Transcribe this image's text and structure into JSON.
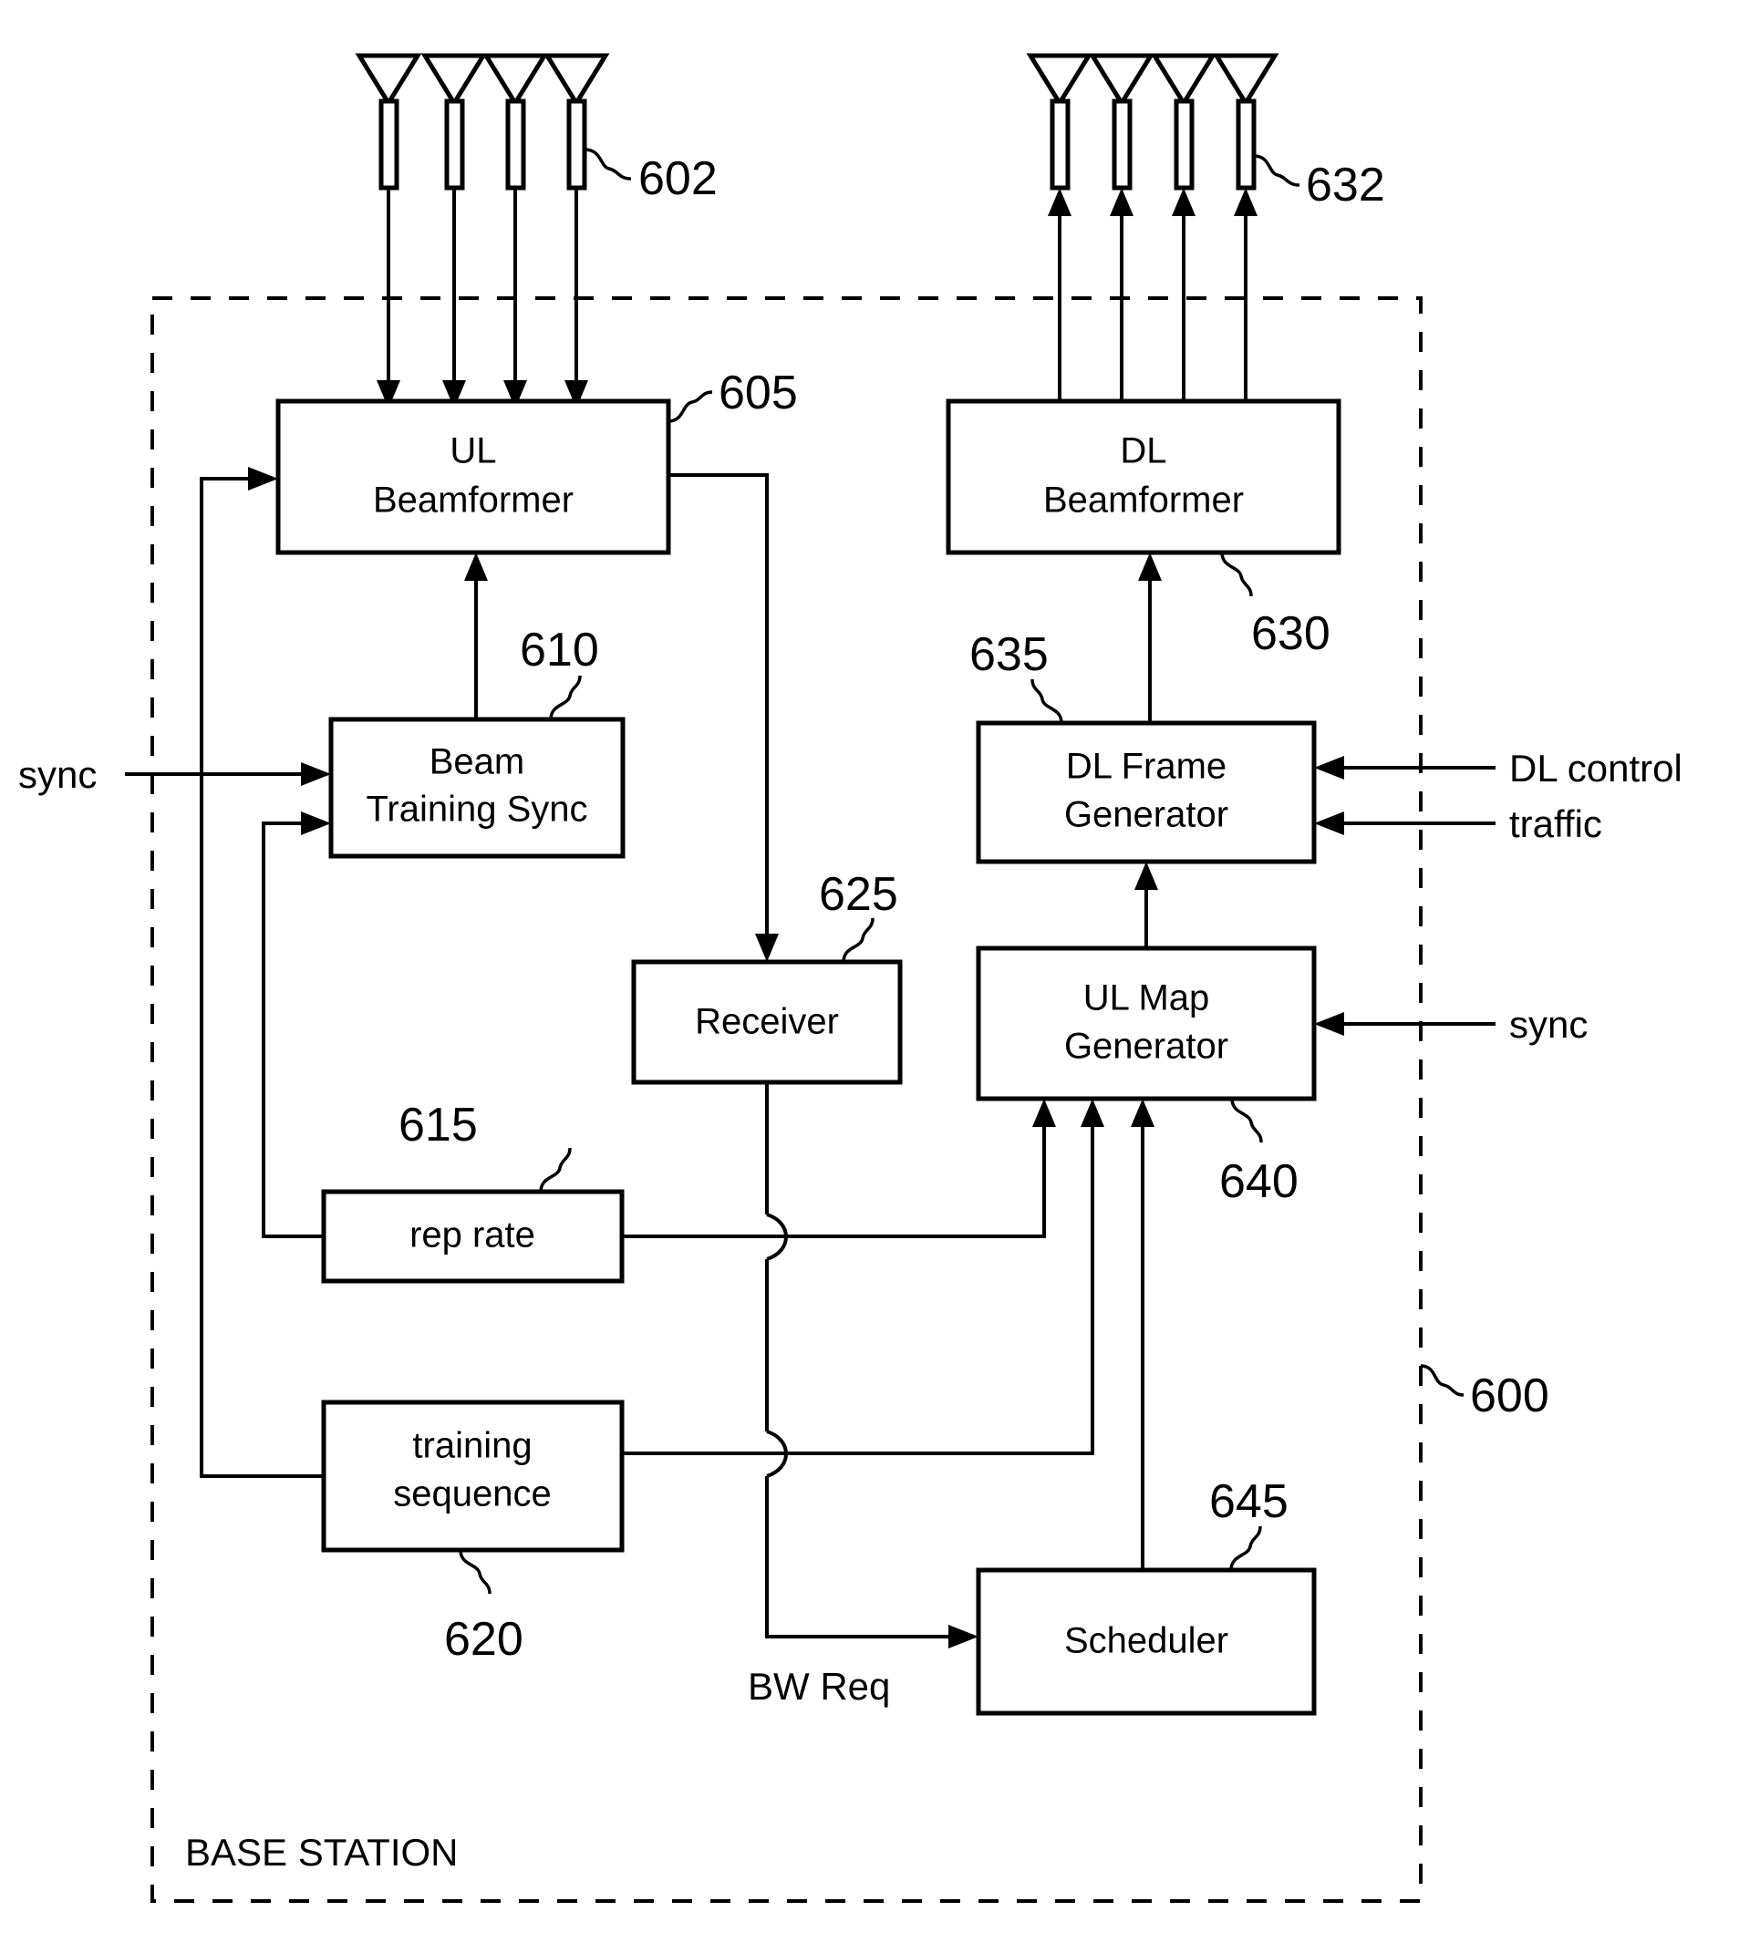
{
  "figure": {
    "frame_label": "BASE STATION",
    "frame_ref": "600"
  },
  "antennas": {
    "uplink_ref": "602",
    "downlink_ref": "632",
    "uplink_count": 4,
    "downlink_count": 4
  },
  "blocks": [
    {
      "id": "ul_beamformer",
      "line1": "UL",
      "line2": "Beamformer",
      "ref": "605"
    },
    {
      "id": "beam_training",
      "line1": "Beam",
      "line2": "Training Sync",
      "ref": "610"
    },
    {
      "id": "rep_rate",
      "line1": "rep rate",
      "line2": "",
      "ref": "615"
    },
    {
      "id": "training_seq",
      "line1": "training",
      "line2": "sequence",
      "ref": "620"
    },
    {
      "id": "receiver",
      "line1": "Receiver",
      "line2": "",
      "ref": "625"
    },
    {
      "id": "dl_beamformer",
      "line1": "DL",
      "line2": "Beamformer",
      "ref": "630"
    },
    {
      "id": "dl_frame_gen",
      "line1": "DL Frame",
      "line2": "Generator",
      "ref": "635"
    },
    {
      "id": "ul_map_gen",
      "line1": "UL Map",
      "line2": "Generator",
      "ref": "640"
    },
    {
      "id": "scheduler",
      "line1": "Scheduler",
      "line2": "",
      "ref": "645"
    }
  ],
  "signals": {
    "sync_left": "sync",
    "sync_right": "sync",
    "dl_control": "DL control",
    "traffic": "traffic",
    "bw_req": "BW Req"
  },
  "chart_data": {
    "type": "diagram",
    "title": "BASE STATION",
    "nodes": [
      {
        "ref": "602",
        "label": "uplink antenna array (4 elements)"
      },
      {
        "ref": "605",
        "label": "UL Beamformer"
      },
      {
        "ref": "610",
        "label": "Beam Training Sync"
      },
      {
        "ref": "615",
        "label": "rep rate"
      },
      {
        "ref": "620",
        "label": "training sequence"
      },
      {
        "ref": "625",
        "label": "Receiver"
      },
      {
        "ref": "630",
        "label": "DL Beamformer"
      },
      {
        "ref": "632",
        "label": "downlink antenna array (4 elements)"
      },
      {
        "ref": "635",
        "label": "DL Frame Generator"
      },
      {
        "ref": "640",
        "label": "UL Map Generator"
      },
      {
        "ref": "645",
        "label": "Scheduler"
      },
      {
        "ref": "600",
        "label": "BASE STATION boundary"
      }
    ],
    "edges": [
      {
        "from": "602",
        "to": "605",
        "label": ""
      },
      {
        "from": "605",
        "to": "625",
        "label": ""
      },
      {
        "from": "610",
        "to": "605",
        "label": ""
      },
      {
        "from": "sync",
        "to": "610",
        "label": "sync"
      },
      {
        "from": "615",
        "to": "610",
        "label": ""
      },
      {
        "from": "615",
        "to": "640",
        "label": ""
      },
      {
        "from": "620",
        "to": "605",
        "label": ""
      },
      {
        "from": "620",
        "to": "640",
        "label": ""
      },
      {
        "from": "625",
        "to": "645",
        "label": "BW Req"
      },
      {
        "from": "645",
        "to": "640",
        "label": ""
      },
      {
        "from": "640",
        "to": "635",
        "label": ""
      },
      {
        "from": "sync",
        "to": "640",
        "label": "sync"
      },
      {
        "from": "DL control",
        "to": "635",
        "label": "DL control"
      },
      {
        "from": "traffic",
        "to": "635",
        "label": "traffic"
      },
      {
        "from": "635",
        "to": "630",
        "label": ""
      },
      {
        "from": "630",
        "to": "632",
        "label": ""
      }
    ]
  }
}
